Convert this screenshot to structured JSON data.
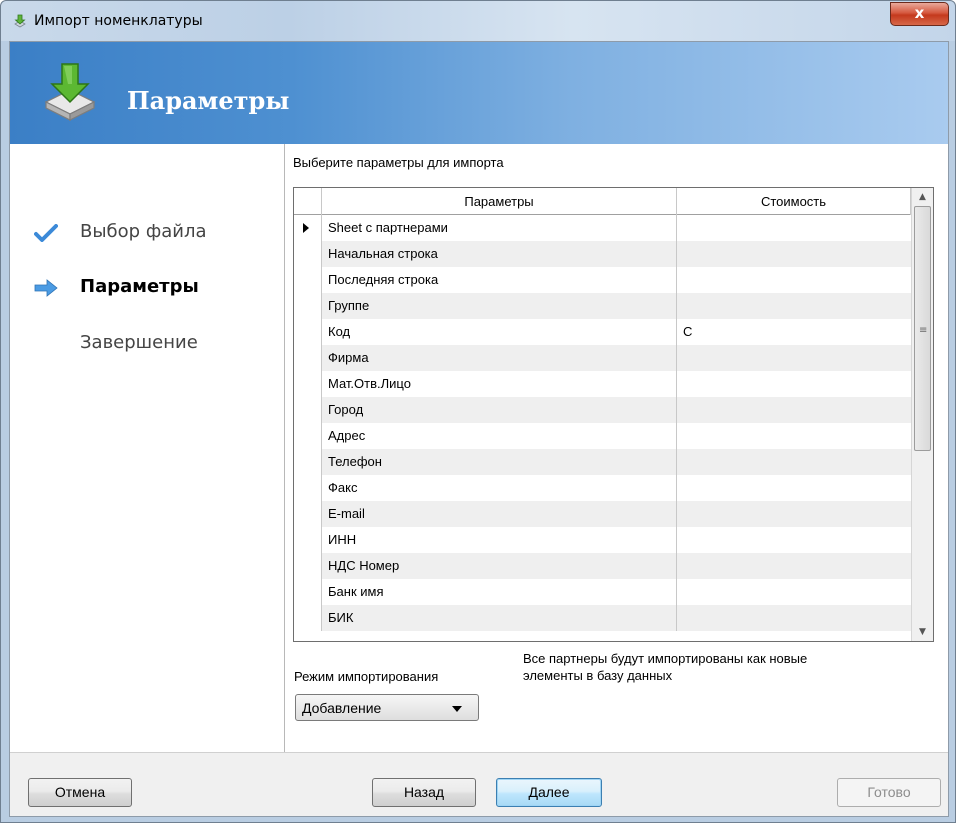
{
  "window": {
    "title": "Импорт номенклатуры",
    "close_label": "x"
  },
  "banner": {
    "title": "Параметры"
  },
  "steps": [
    {
      "label": "Выбор файла",
      "state": "done"
    },
    {
      "label": "Параметры",
      "state": "current"
    },
    {
      "label": "Завершение",
      "state": "pending"
    }
  ],
  "main": {
    "instruction": "Выберите параметры для импорта",
    "grid": {
      "columns": [
        "Параметры",
        "Стоимость"
      ],
      "rows": [
        {
          "param": "Sheet с партнерами",
          "cost": "",
          "selected": true
        },
        {
          "param": "Начальная строка",
          "cost": ""
        },
        {
          "param": "Последняя строка",
          "cost": ""
        },
        {
          "param": "Группе",
          "cost": ""
        },
        {
          "param": "Код",
          "cost": "C"
        },
        {
          "param": "Фирма",
          "cost": ""
        },
        {
          "param": "Мат.Отв.Лицо",
          "cost": ""
        },
        {
          "param": "Город",
          "cost": ""
        },
        {
          "param": "Адрес",
          "cost": ""
        },
        {
          "param": "Телефон",
          "cost": ""
        },
        {
          "param": "Факс",
          "cost": ""
        },
        {
          "param": "E-mail",
          "cost": ""
        },
        {
          "param": "ИНН",
          "cost": ""
        },
        {
          "param": "НДС Номер",
          "cost": ""
        },
        {
          "param": "Банк имя",
          "cost": ""
        },
        {
          "param": "БИК",
          "cost": ""
        }
      ]
    },
    "import_mode": {
      "label": "Режим импортирования",
      "value": "Добавление",
      "note_line1": "Все партнеры будут импортированы как новые",
      "note_line2": "элементы в базу данных"
    }
  },
  "buttons": {
    "cancel": "Отмена",
    "back": "Назад",
    "next": "Далее",
    "finish": "Готово"
  },
  "colors": {
    "banner_start": "#3b7fc6",
    "banner_end": "#a9cbef",
    "close_button": "#c4391d",
    "default_button_border": "#3c7fb1"
  }
}
